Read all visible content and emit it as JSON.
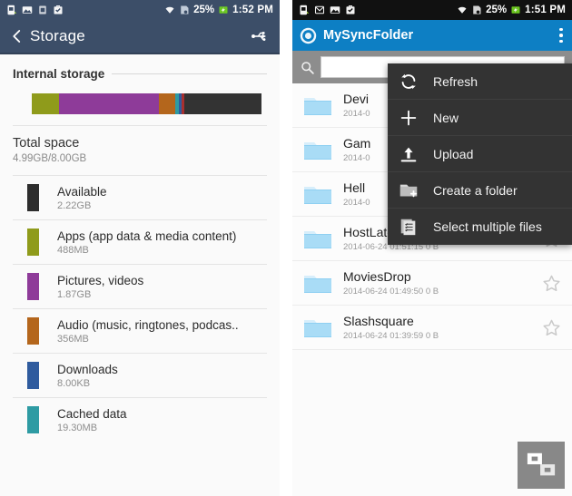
{
  "left_screen": {
    "statusbar": {
      "icons": [
        "sim-card-icon",
        "picture-icon",
        "sd-card-icon",
        "briefcase-icon"
      ],
      "wifi_icon": "wifi-icon",
      "signal_icon": "mobile-data-icon",
      "battery_percent": "25%",
      "battery_icon": "battery-charging-icon",
      "time": "1:52 PM"
    },
    "header": {
      "back_icon": "back-chevron-icon",
      "title": "Storage",
      "usb_icon": "usb-icon"
    },
    "section": {
      "title": "Internal storage"
    },
    "total": {
      "label": "Total space",
      "value": "4.99GB/8.00GB"
    },
    "usage_segments": [
      {
        "name": "apps",
        "color": "#8f9b1b",
        "pct": 12.0
      },
      {
        "name": "pictures",
        "color": "#8e3b99",
        "pct": 43.5
      },
      {
        "name": "audio",
        "color": "#b4661c",
        "pct": 7.0
      },
      {
        "name": "cached",
        "color": "#2e9ba3",
        "pct": 1.6
      },
      {
        "name": "downloads",
        "color": "#2f5b9e",
        "pct": 1.2
      },
      {
        "name": "misc",
        "color": "#a83030",
        "pct": 1.2
      },
      {
        "name": "available",
        "color": "#333333",
        "pct": 33.5
      }
    ],
    "categories": [
      {
        "name": "Available",
        "size": "2.22GB",
        "color": "#2d2d2d"
      },
      {
        "name": "Apps (app data & media content)",
        "size": "488MB",
        "color": "#8f9b1b"
      },
      {
        "name": "Pictures, videos",
        "size": "1.87GB",
        "color": "#8e3b99"
      },
      {
        "name": "Audio (music, ringtones, podcas..",
        "size": "356MB",
        "color": "#b4661c"
      },
      {
        "name": "Downloads",
        "size": "8.00KB",
        "color": "#2f5b9e"
      },
      {
        "name": "Cached data",
        "size": "19.30MB",
        "color": "#2e9ba3"
      }
    ]
  },
  "right_screen": {
    "statusbar": {
      "icons": [
        "sim-card-icon",
        "mail-icon",
        "picture-icon",
        "briefcase-icon"
      ],
      "wifi_icon": "wifi-icon",
      "signal_icon": "mobile-data-icon",
      "battery_percent": "25%",
      "battery_icon": "battery-charging-icon",
      "time": "1:51 PM"
    },
    "header": {
      "logo_icon": "app-logo-icon",
      "title": "MySyncFolder",
      "overflow_icon": "overflow-menu-icon"
    },
    "search": {
      "icon": "search-icon",
      "value": "",
      "placeholder": ""
    },
    "files": [
      {
        "name": "Devi",
        "meta": "2014-0",
        "icon": "folder-icon",
        "star": "star-outline-icon"
      },
      {
        "name": "Gam",
        "meta": "2014-0",
        "icon": "folder-icon",
        "star": "star-outline-icon"
      },
      {
        "name": "Hell",
        "meta": "2014-0",
        "icon": "folder-icon",
        "star": "star-outline-icon"
      },
      {
        "name": "HostLater",
        "meta": "2014-06-24 01:51:15 0 B",
        "icon": "folder-icon",
        "star": "star-outline-icon"
      },
      {
        "name": "MoviesDrop",
        "meta": "2014-06-24 01:49:50 0 B",
        "icon": "folder-icon",
        "star": "star-outline-icon"
      },
      {
        "name": "Slashsquare",
        "meta": "2014-06-24 01:39:59 0 B",
        "icon": "folder-icon",
        "star": "star-outline-icon"
      }
    ],
    "menu": {
      "items": [
        {
          "label": "Refresh",
          "icon": "refresh-icon"
        },
        {
          "label": "New",
          "icon": "plus-icon"
        },
        {
          "label": "Upload",
          "icon": "upload-icon"
        },
        {
          "label": "Create a folder",
          "icon": "new-folder-icon"
        },
        {
          "label": "Select multiple files",
          "icon": "select-multiple-icon"
        }
      ]
    },
    "watermark": {
      "icon": "slashsquare-logo-icon"
    }
  },
  "colors": {
    "status_left_bg": "#3c4e68",
    "status_right_bg": "#111111",
    "app_header_blue": "#0d7fc4",
    "menu_bg": "#333333",
    "search_bar_bg": "#8d8d8d"
  }
}
